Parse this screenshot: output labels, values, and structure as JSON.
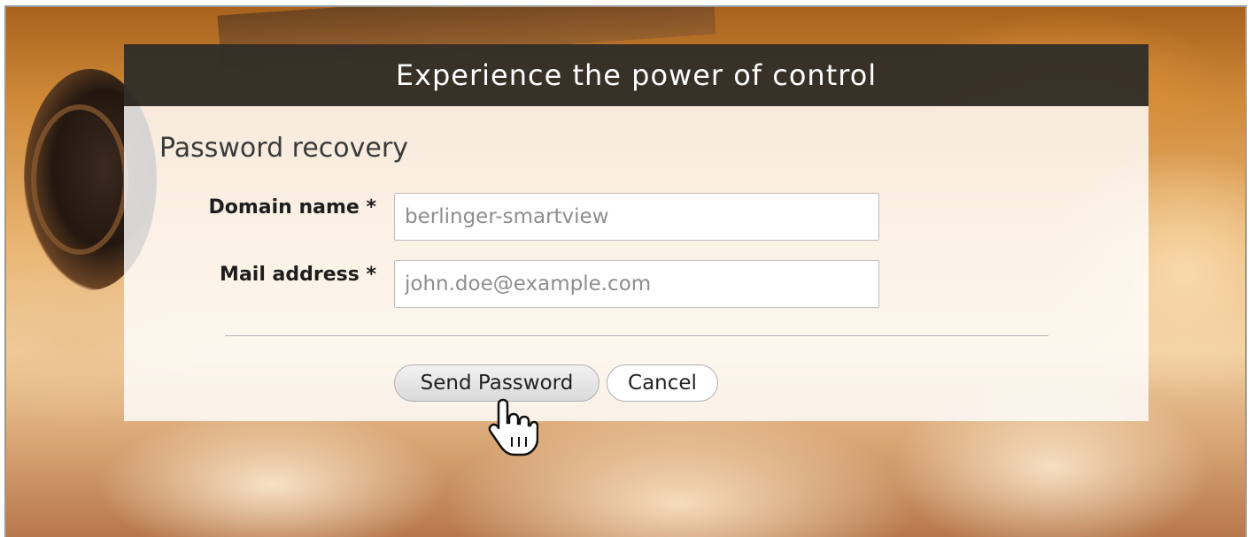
{
  "dialog": {
    "title": "Experience the power of control",
    "section_title": "Password recovery"
  },
  "form": {
    "domain": {
      "label": "Domain name *",
      "placeholder": "berlinger-smartview"
    },
    "mail": {
      "label": "Mail address *",
      "placeholder": "john.doe@example.com"
    }
  },
  "buttons": {
    "send": "Send Password",
    "cancel": "Cancel"
  },
  "icons": {
    "cursor": "hand-pointer-icon"
  }
}
